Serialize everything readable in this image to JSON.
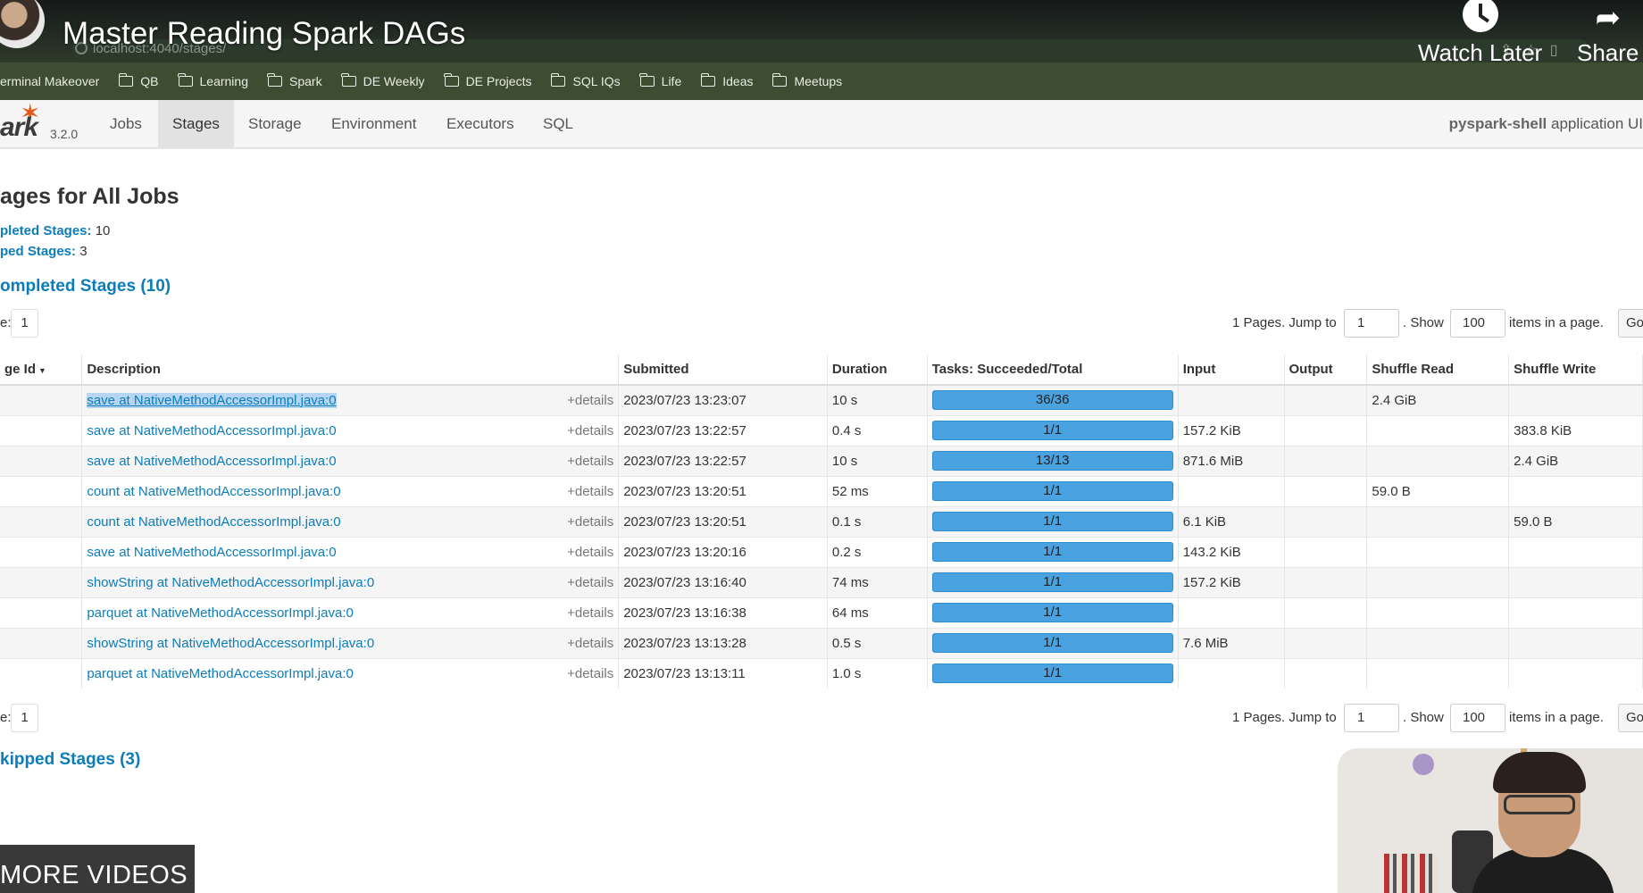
{
  "video": {
    "title": "Master Reading Spark DAGs",
    "watch_later": "Watch Later",
    "share": "Share",
    "more_videos": "MORE VIDEOS"
  },
  "browser": {
    "url": "localhost:4040/stages/",
    "bookmarks": [
      {
        "label": "erminal Makeover",
        "has_icon": false
      },
      {
        "label": "QB",
        "has_icon": true
      },
      {
        "label": "Learning",
        "has_icon": true
      },
      {
        "label": "Spark",
        "has_icon": true
      },
      {
        "label": "DE Weekly",
        "has_icon": true
      },
      {
        "label": "DE Projects",
        "has_icon": true
      },
      {
        "label": "SQL IQs",
        "has_icon": true
      },
      {
        "label": "Life",
        "has_icon": true
      },
      {
        "label": "Ideas",
        "has_icon": true
      },
      {
        "label": "Meetups",
        "has_icon": true
      }
    ]
  },
  "spark": {
    "logo": "ark",
    "version": "3.2.0",
    "tabs": [
      "Jobs",
      "Stages",
      "Storage",
      "Environment",
      "Executors",
      "SQL"
    ],
    "active_tab": "Stages",
    "app_name": "pyspark-shell",
    "app_suffix": " application UI"
  },
  "page": {
    "title": "ages for All Jobs",
    "completed_label": "pleted Stages:",
    "completed_count": "10",
    "skipped_label": "ped Stages:",
    "skipped_count": "3",
    "completed_section": "ompleted Stages (10)",
    "skipped_section": "kipped Stages (3)"
  },
  "pager": {
    "page_label": "e:",
    "page_value": "1",
    "pages_text": "1 Pages. Jump to",
    "jump_value": "1",
    "show_text": ". Show",
    "show_value": "100",
    "items_text": "items in a page.",
    "go_label": "Go"
  },
  "table": {
    "headers": [
      "ge Id",
      "Description",
      "Submitted",
      "Duration",
      "Tasks: Succeeded/Total",
      "Input",
      "Output",
      "Shuffle Read",
      "Shuffle Write"
    ],
    "details_label": "+details",
    "rows": [
      {
        "desc": "save at NativeMethodAccessorImpl.java:0",
        "submitted": "2023/07/23 13:23:07",
        "duration": "10 s",
        "tasks": "36/36",
        "input": "",
        "output": "",
        "shuffle_read": "2.4 GiB",
        "shuffle_write": ""
      },
      {
        "desc": "save at NativeMethodAccessorImpl.java:0",
        "submitted": "2023/07/23 13:22:57",
        "duration": "0.4 s",
        "tasks": "1/1",
        "input": "157.2 KiB",
        "output": "",
        "shuffle_read": "",
        "shuffle_write": "383.8 KiB"
      },
      {
        "desc": "save at NativeMethodAccessorImpl.java:0",
        "submitted": "2023/07/23 13:22:57",
        "duration": "10 s",
        "tasks": "13/13",
        "input": "871.6 MiB",
        "output": "",
        "shuffle_read": "",
        "shuffle_write": "2.4 GiB"
      },
      {
        "desc": "count at NativeMethodAccessorImpl.java:0",
        "submitted": "2023/07/23 13:20:51",
        "duration": "52 ms",
        "tasks": "1/1",
        "input": "",
        "output": "",
        "shuffle_read": "59.0 B",
        "shuffle_write": ""
      },
      {
        "desc": "count at NativeMethodAccessorImpl.java:0",
        "submitted": "2023/07/23 13:20:51",
        "duration": "0.1 s",
        "tasks": "1/1",
        "input": "6.1 KiB",
        "output": "",
        "shuffle_read": "",
        "shuffle_write": "59.0 B"
      },
      {
        "desc": "save at NativeMethodAccessorImpl.java:0",
        "submitted": "2023/07/23 13:20:16",
        "duration": "0.2 s",
        "tasks": "1/1",
        "input": "143.2 KiB",
        "output": "",
        "shuffle_read": "",
        "shuffle_write": ""
      },
      {
        "desc": "showString at NativeMethodAccessorImpl.java:0",
        "submitted": "2023/07/23 13:16:40",
        "duration": "74 ms",
        "tasks": "1/1",
        "input": "157.2 KiB",
        "output": "",
        "shuffle_read": "",
        "shuffle_write": ""
      },
      {
        "desc": "parquet at NativeMethodAccessorImpl.java:0",
        "submitted": "2023/07/23 13:16:38",
        "duration": "64 ms",
        "tasks": "1/1",
        "input": "",
        "output": "",
        "shuffle_read": "",
        "shuffle_write": ""
      },
      {
        "desc": "showString at NativeMethodAccessorImpl.java:0",
        "submitted": "2023/07/23 13:13:28",
        "duration": "0.5 s",
        "tasks": "1/1",
        "input": "7.6 MiB",
        "output": "",
        "shuffle_read": "",
        "shuffle_write": ""
      },
      {
        "desc": "parquet at NativeMethodAccessorImpl.java:0",
        "submitted": "2023/07/23 13:13:11",
        "duration": "1.0 s",
        "tasks": "1/1",
        "input": "",
        "output": "",
        "shuffle_read": "",
        "shuffle_write": ""
      }
    ]
  },
  "colors": {
    "link": "#0b7dba",
    "progress": "#4aa3e0",
    "bookmark_bar": "#3d4d31"
  }
}
